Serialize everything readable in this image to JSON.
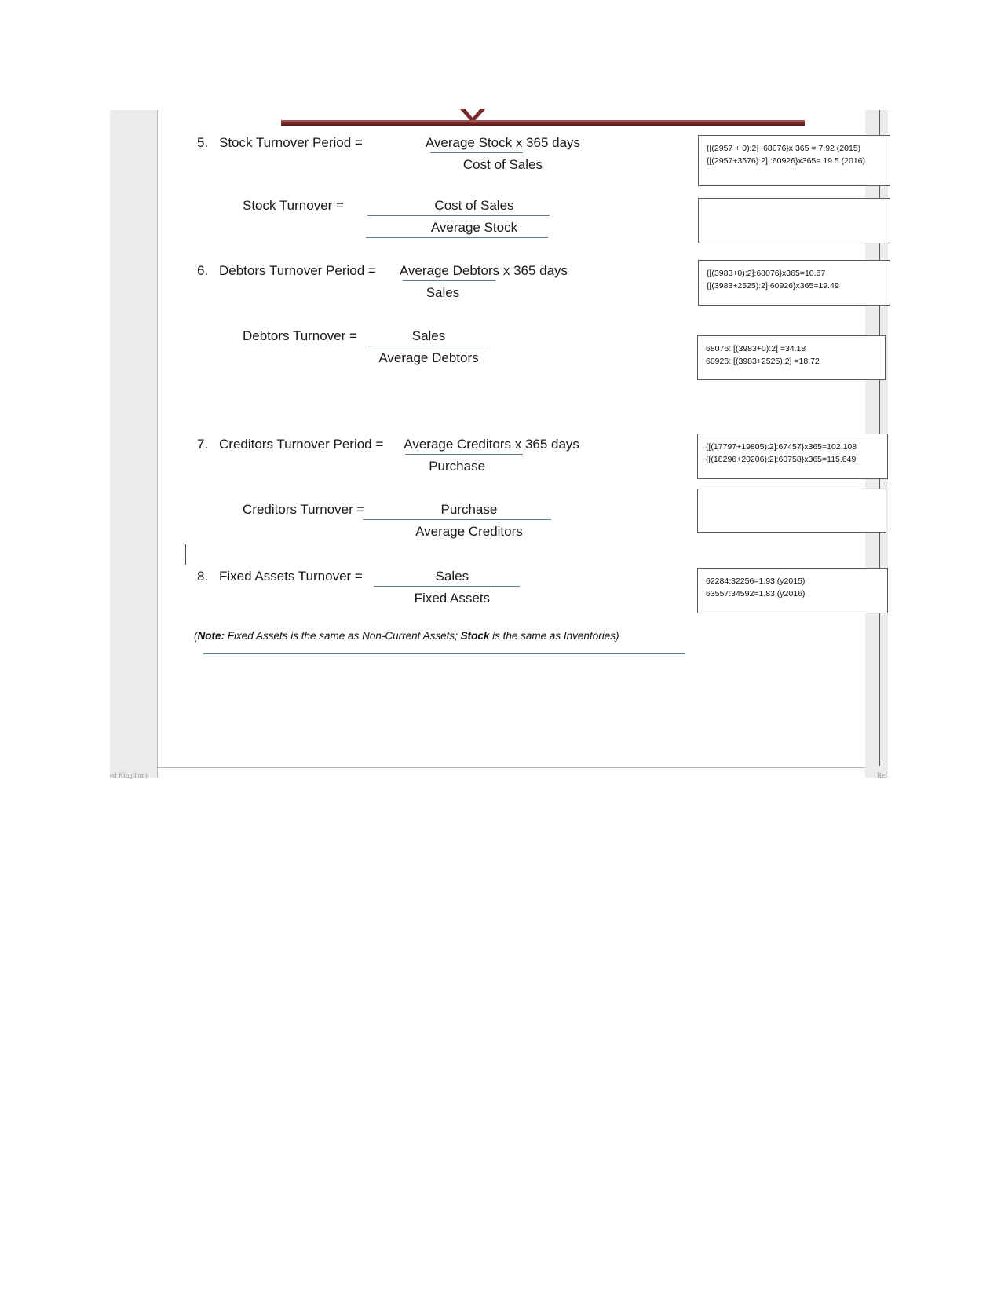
{
  "document": {
    "title": "Accounting Ratios — Turnover Formulas (page excerpt)",
    "footer_left": "ed Kingdom)",
    "footer_right": "Ref"
  },
  "formulas": [
    {
      "number": "5.",
      "label": "Stock Turnover Period =",
      "numerator": "Average Stock x 365 days",
      "denominator": "Cost of Sales"
    },
    {
      "number": "",
      "label": "Stock Turnover  =",
      "numerator": "Cost of Sales",
      "denominator": "Average Stock"
    },
    {
      "number": "6.",
      "label": "Debtors Turnover Period =",
      "numerator": "Average Debtors x 365 days",
      "denominator": "Sales"
    },
    {
      "number": "",
      "label": "Debtors Turnover =",
      "numerator": "Sales",
      "denominator": "Average Debtors"
    },
    {
      "number": "7.",
      "label": "Creditors Turnover Period =",
      "numerator": "Average Creditors x 365 days",
      "denominator": "Purchase"
    },
    {
      "number": "",
      "label": "Creditors Turnover =",
      "numerator": "Purchase",
      "denominator": "Average Creditors"
    },
    {
      "number": "8.",
      "label": "Fixed Assets Turnover =",
      "numerator": "Sales",
      "denominator": "Fixed Assets"
    }
  ],
  "annotations": [
    {
      "id": "stock-turnover-period-note",
      "line1": "{[(2957 + 0):2] :68076}x 365 = 7.92 (2015)",
      "line2": "{[(2957+3576):2] :60926}x365= 19.5 (2016)"
    },
    {
      "id": "stock-turnover-note",
      "line1": "",
      "line2": ""
    },
    {
      "id": "debtors-turnover-period-note",
      "line1": "{[(3983+0):2]:68076}x365=10.67",
      "line2": "{[(3983+2525):2]:60926}x365=19.49"
    },
    {
      "id": "debtors-turnover-note",
      "line1": "68076: [(3983+0):2] =34.18",
      "line2": "60926: [(3983+2525):2] =18.72"
    },
    {
      "id": "creditors-turnover-period-note",
      "line1": "{[(17797+19805):2]:67457}x365=102.108",
      "line2": "{[(18296+20206):2]:60758}x365=115.649"
    },
    {
      "id": "creditors-turnover-note",
      "line1": "",
      "line2": ""
    },
    {
      "id": "fixed-assets-turnover-note",
      "line1": "62284:32256=1.93 (y2015)",
      "line2": "63557:34592=1.83 (y2016)"
    }
  ],
  "bottom_note": {
    "open_paren": "(",
    "bold1": "Note:",
    "text1": " Fixed Assets is the same as Non-Current Assets; ",
    "bold2": "Stock",
    "text2": " is the same as Inventories)"
  },
  "colors": {
    "header_bar": "#7b2a2a",
    "fraction_rule": "#5b7f93",
    "note_border": "#595959",
    "gutter": "#ececec"
  }
}
